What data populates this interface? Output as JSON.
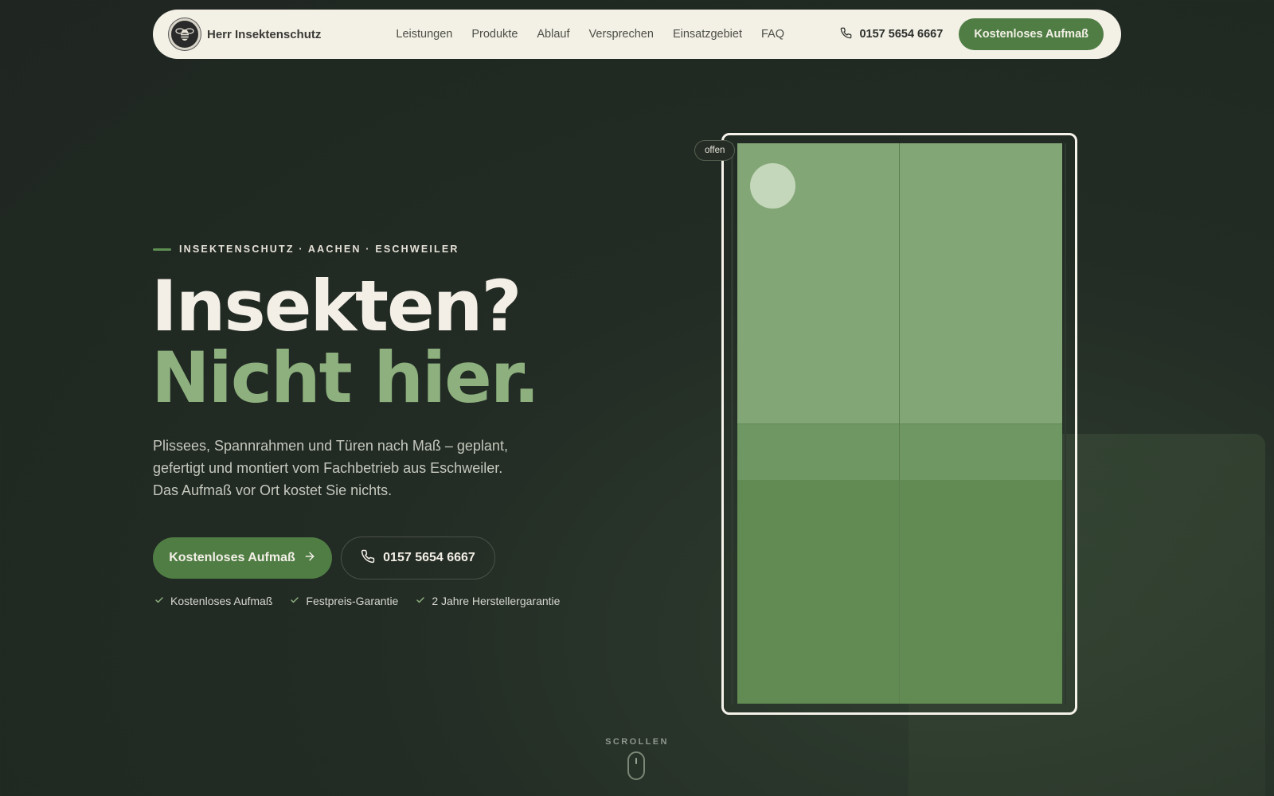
{
  "nav": {
    "brand_name": "Herr Insektenschutz",
    "links": [
      "Leistungen",
      "Produkte",
      "Ablauf",
      "Versprechen",
      "Einsatzgebiet",
      "FAQ"
    ],
    "phone": "0157 5654 6667",
    "cta_label": "Kostenloses Aufmaß"
  },
  "hero": {
    "eyebrow": "INSEKTENSCHUTZ · AACHEN · ESCHWEILER",
    "title_line1": "Insekten?",
    "title_line2": "Nicht hier.",
    "lead": "Plissees, Spannrahmen und Türen nach Maß – geplant, gefertigt und montiert vom Fachbetrieb aus Eschweiler. Das Aufmaß vor Ort kostet Sie nichts.",
    "primary_cta": "Kostenloses Aufmaß",
    "secondary_cta": "0157 5654 6667",
    "checks": [
      "Kostenloses Aufmaß",
      "Festpreis-Garantie",
      "2 Jahre Herstellergarantie"
    ]
  },
  "illustration": {
    "status_pill": "offen"
  },
  "scroll_label": "SCROLLEN",
  "colors": {
    "background": "#222b24",
    "accent_green": "#4f7d44",
    "headline_green": "#8db07e",
    "cream": "#f3f0e6"
  },
  "icons": {
    "logo": "bee-logo-icon",
    "phone": "phone-icon",
    "arrow": "arrow-right-icon",
    "check": "check-icon",
    "mouse": "scroll-mouse-icon"
  }
}
